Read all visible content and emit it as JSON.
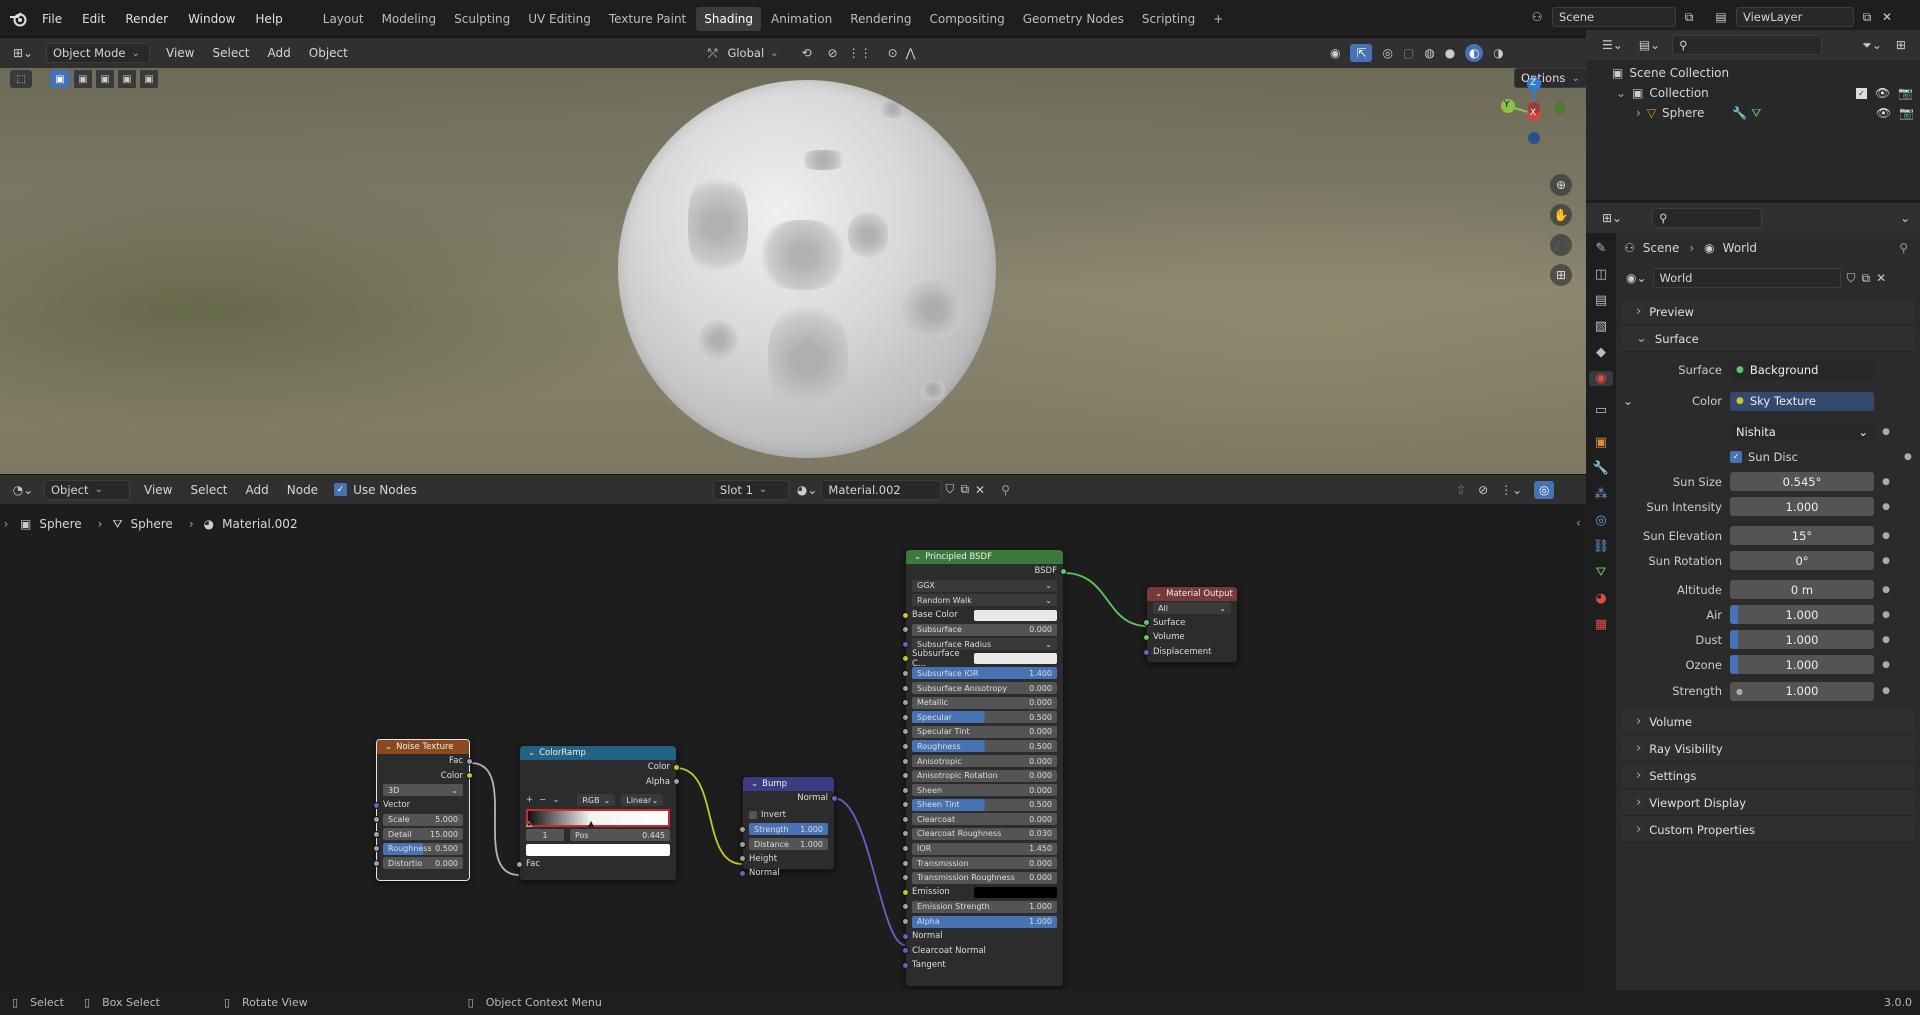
{
  "topbar": {
    "menu": [
      "File",
      "Edit",
      "Render",
      "Window",
      "Help"
    ],
    "workspaces": [
      "Layout",
      "Modeling",
      "Sculpting",
      "UV Editing",
      "Texture Paint",
      "Shading",
      "Animation",
      "Rendering",
      "Compositing",
      "Geometry Nodes",
      "Scripting"
    ],
    "active_workspace": "Shading",
    "add_tab": "+",
    "scene": "Scene",
    "view_layer": "ViewLayer"
  },
  "viewport": {
    "mode": "Object Mode",
    "menu": [
      "View",
      "Select",
      "Add",
      "Object"
    ],
    "transform_orientation": "Global",
    "options_label": "Options",
    "gizmo": {
      "x": "X",
      "y": "Y",
      "z": "Z"
    }
  },
  "node_editor": {
    "editor_type": "Object",
    "menu": [
      "View",
      "Select",
      "Add",
      "Node"
    ],
    "use_nodes_label": "Use Nodes",
    "slot": "Slot 1",
    "material": "Material.002",
    "breadcrumb": [
      "Sphere",
      "Sphere",
      "Material.002"
    ],
    "nodes": {
      "noise": {
        "title": "Noise Texture",
        "outputs": [
          "Fac",
          "Color"
        ],
        "dimensions": "3D",
        "vector": "Vector",
        "fields": [
          {
            "label": "Scale",
            "value": "5.000"
          },
          {
            "label": "Detail",
            "value": "15.000"
          },
          {
            "label": "Roughness",
            "value": "0.500"
          },
          {
            "label": "Distortio",
            "value": "0.000"
          }
        ]
      },
      "colorramp": {
        "title": "ColorRamp",
        "outputs": [
          "Color",
          "Alpha"
        ],
        "color_mode": "RGB",
        "interpolation": "Linear",
        "stop_index": "1",
        "pos_label": "Pos",
        "pos_value": "0.445",
        "input": "Fac"
      },
      "bump": {
        "title": "Bump",
        "output": "Normal",
        "invert": "Invert",
        "fields": [
          {
            "label": "Strength",
            "value": "1.000"
          },
          {
            "label": "Distance",
            "value": "1.000"
          }
        ],
        "inputs": [
          "Height",
          "Normal"
        ]
      },
      "bsdf": {
        "title": "Principled BSDF",
        "output": "BSDF",
        "distribution": "GGX",
        "subsurface_method": "Random Walk",
        "base_color": "Base Color",
        "rows": [
          {
            "label": "Subsurface",
            "value": "0.000"
          },
          {
            "label": "Subsurface Radius",
            "value": ""
          },
          {
            "label": "Subsurface C...",
            "value": ""
          },
          {
            "label": "Subsurface IOR",
            "value": "1.400"
          },
          {
            "label": "Subsurface Anisotropy",
            "value": "0.000"
          },
          {
            "label": "Metallic",
            "value": "0.000"
          },
          {
            "label": "Specular",
            "value": "0.500"
          },
          {
            "label": "Specular Tint",
            "value": "0.000"
          },
          {
            "label": "Roughness",
            "value": "0.500"
          },
          {
            "label": "Anisotropic",
            "value": "0.000"
          },
          {
            "label": "Anisotropic Rotation",
            "value": "0.000"
          },
          {
            "label": "Sheen",
            "value": "0.000"
          },
          {
            "label": "Sheen Tint",
            "value": "0.500"
          },
          {
            "label": "Clearcoat",
            "value": "0.000"
          },
          {
            "label": "Clearcoat Roughness",
            "value": "0.030"
          },
          {
            "label": "IOR",
            "value": "1.450"
          },
          {
            "label": "Transmission",
            "value": "0.000"
          },
          {
            "label": "Transmission Roughness",
            "value": "0.000"
          },
          {
            "label": "Emission",
            "value": ""
          },
          {
            "label": "Emission Strength",
            "value": "1.000"
          },
          {
            "label": "Alpha",
            "value": "1.000"
          }
        ],
        "tail": [
          "Normal",
          "Clearcoat Normal",
          "Tangent"
        ]
      },
      "output": {
        "title": "Material Output",
        "target": "All",
        "inputs": [
          "Surface",
          "Volume",
          "Displacement"
        ]
      }
    }
  },
  "outliner": {
    "root": "Scene Collection",
    "collection": "Collection",
    "object": "Sphere"
  },
  "properties": {
    "breadcrumb": [
      "Scene",
      "World"
    ],
    "world_name": "World",
    "panels": {
      "preview": "Preview",
      "surface": "Surface",
      "volume": "Volume",
      "ray_visibility": "Ray Visibility",
      "settings": "Settings",
      "viewport_display": "Viewport Display",
      "custom_properties": "Custom Properties"
    },
    "surface_label": "Surface",
    "surface_value": "Background",
    "color_label": "Color",
    "color_value": "Sky Texture",
    "sky_type": "Nishita",
    "sun_disc": "Sun Disc",
    "fields": [
      {
        "label": "Sun Size",
        "value": "0.545°"
      },
      {
        "label": "Sun Intensity",
        "value": "1.000"
      },
      {
        "label": "Sun Elevation",
        "value": "15°"
      },
      {
        "label": "Sun Rotation",
        "value": "0°"
      },
      {
        "label": "Altitude",
        "value": "0 m"
      },
      {
        "label": "Air",
        "value": "1.000"
      },
      {
        "label": "Dust",
        "value": "1.000"
      },
      {
        "label": "Ozone",
        "value": "1.000"
      }
    ],
    "strength_label": "Strength",
    "strength_value": "1.000"
  },
  "statusbar": {
    "items": [
      "Select",
      "Box Select",
      "Rotate View",
      "Object Context Menu"
    ],
    "version": "3.0.0"
  },
  "colors": {
    "accent": "#4772b3",
    "noise_header": "#8b4a1e",
    "colorramp_header": "#246283",
    "bump_header": "#3c3c83",
    "bsdf_header": "#3c7a3c",
    "output_header": "#7a3939"
  }
}
